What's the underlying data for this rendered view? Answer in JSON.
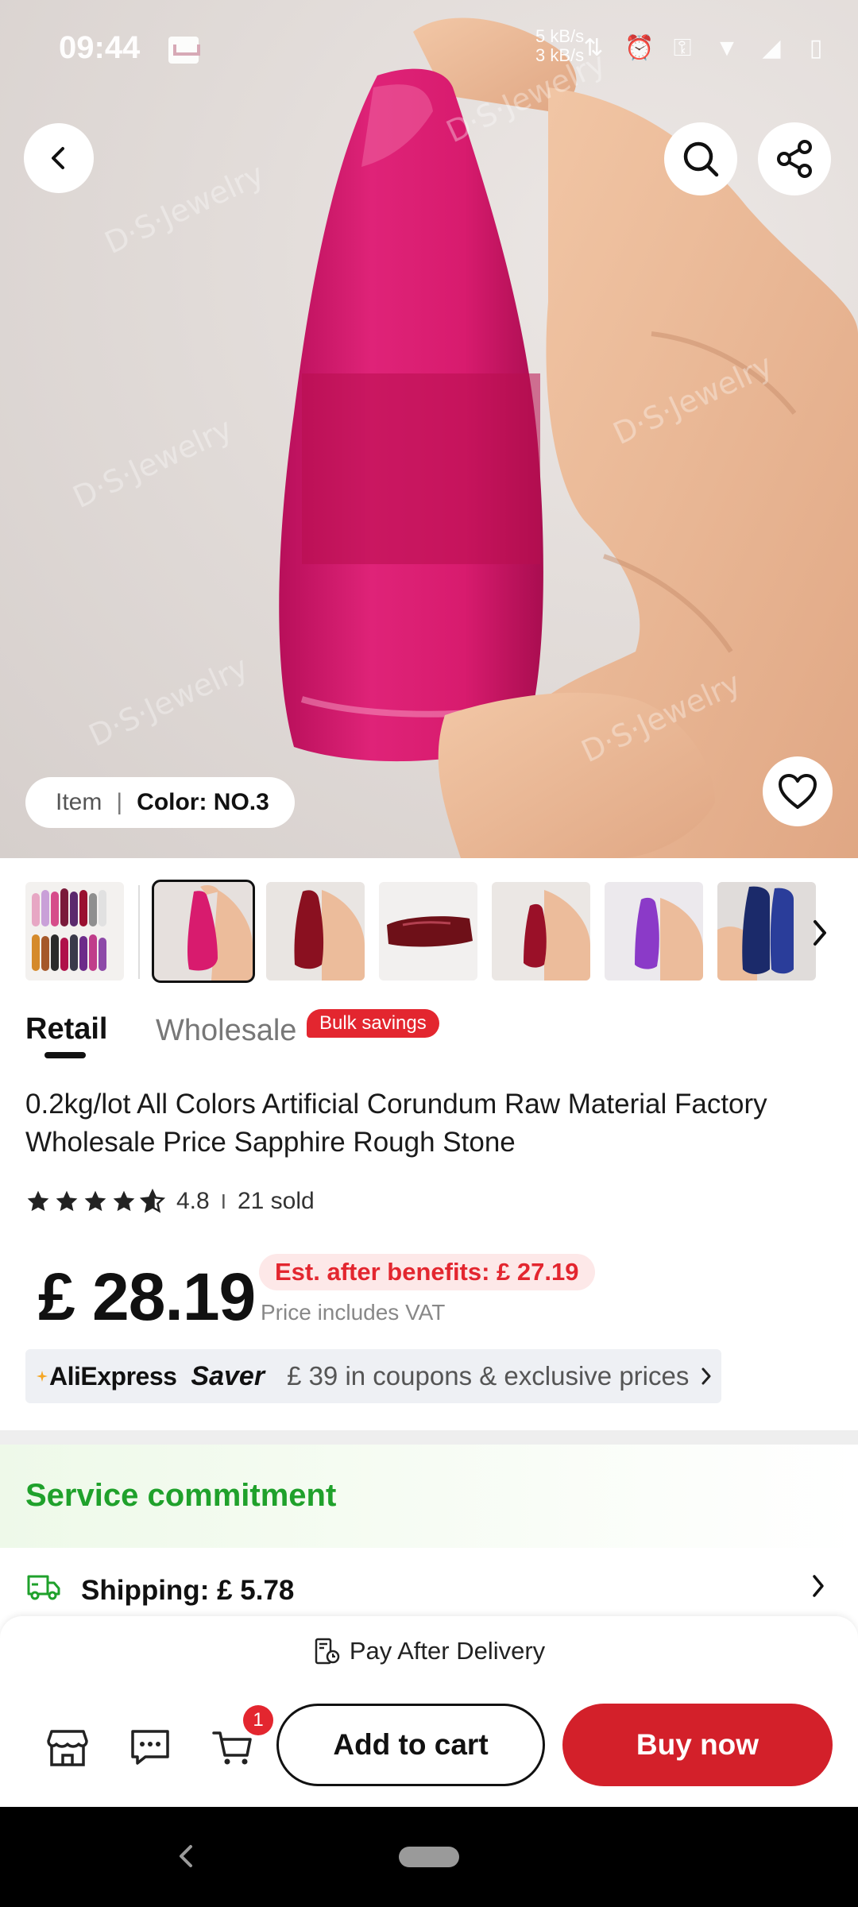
{
  "status_bar": {
    "time": "09:44",
    "speed_up": "5 kB/s",
    "speed_down": "3 kB/s"
  },
  "hero": {
    "watermark": "D·S·Jewelry",
    "variant_item_label": "Item",
    "variant_separator": "|",
    "variant_color": "Color: NO.3"
  },
  "thumbnails": [
    {
      "name": "assorted-colors",
      "selected": false
    },
    {
      "name": "no3-pink",
      "selected": true
    },
    {
      "name": "dark-red-hand",
      "selected": false
    },
    {
      "name": "dark-red-bar",
      "selected": false
    },
    {
      "name": "dark-red-small",
      "selected": false
    },
    {
      "name": "purple",
      "selected": false
    },
    {
      "name": "blue",
      "selected": false
    }
  ],
  "tabs": {
    "retail": "Retail",
    "wholesale": "Wholesale",
    "bulk_badge": "Bulk savings"
  },
  "product": {
    "title": "0.2kg/lot All Colors Artificial Corundum Raw Material Factory Wholesale Price Sapphire Rough Stone",
    "rating": 4.8,
    "rating_text": "4.8",
    "rating_separator": "I",
    "sold": "21 sold",
    "price": "£ 28.19",
    "benefit_price": "Est. after benefits:  £ 27.19",
    "vat_note": "Price includes VAT"
  },
  "saver": {
    "brand": "AliExpress",
    "word": "Saver",
    "text": "£ 39 in coupons & exclusive prices"
  },
  "service": {
    "title": "Service commitment",
    "shipping": "Shipping:  £ 5.78"
  },
  "bottom_bar": {
    "pay_after": "Pay After Delivery",
    "cart_count": "1",
    "add_to_cart": "Add to cart",
    "buy_now": "Buy now"
  },
  "colors": {
    "accent_red": "#d3202a",
    "service_green": "#1fa12b",
    "stone_pink": "#d41a6e"
  }
}
